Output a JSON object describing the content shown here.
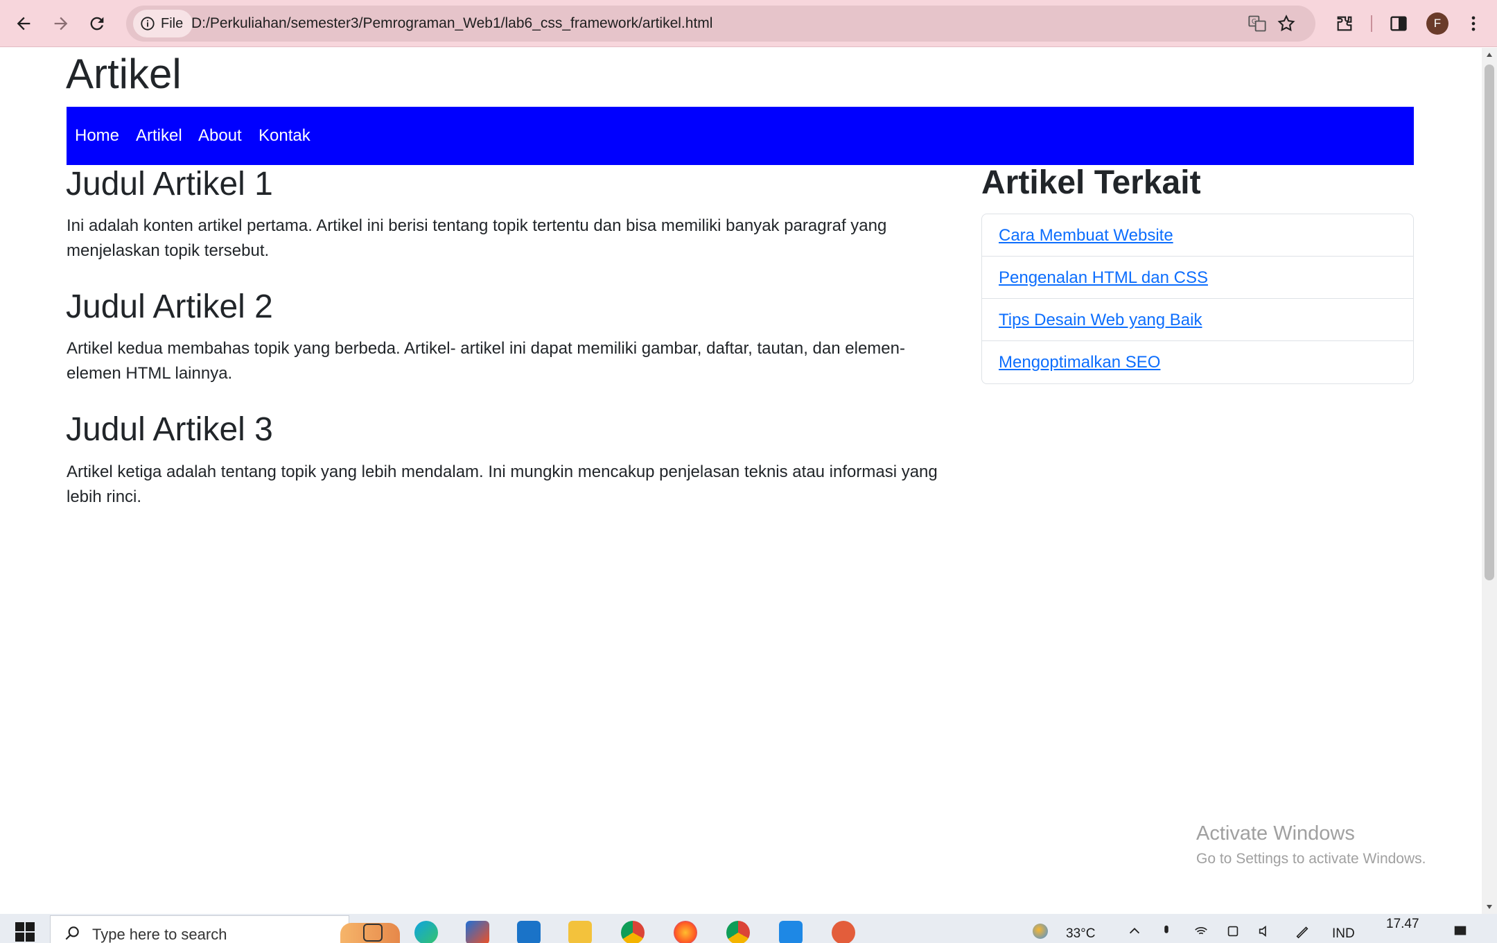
{
  "browser": {
    "site_chip": "File",
    "url": "D:/Perkuliahan/semester3/Pemrograman_Web1/lab6_css_framework/artikel.html",
    "profile_initial": "F"
  },
  "page": {
    "site_title": "Artikel",
    "nav": [
      "Home",
      "Artikel",
      "About",
      "Kontak"
    ],
    "articles": [
      {
        "title": "Judul Artikel 1",
        "line1": "Ini adalah konten artikel pertama. Artikel ini berisi tentang topik tertentu dan bisa memiliki banyak paragraf yang",
        "line2": "menjelaskan topik tersebut."
      },
      {
        "title": "Judul Artikel 2",
        "line1": "Artikel kedua membahas topik yang berbeda. Artikel- artikel ini dapat memiliki gambar, daftar, tautan, dan elemen-",
        "line2": "elemen HTML lainnya."
      },
      {
        "title": "Judul Artikel 3",
        "line1": "Artikel ketiga adalah tentang topik yang lebih mendalam. Ini mungkin mencakup penjelasan teknis atau informasi yang",
        "line2": "lebih rinci."
      }
    ],
    "sidebar": {
      "title": "Artikel Terkait",
      "links": [
        "Cara Membuat Website",
        "Pengenalan HTML dan CSS",
        "Tips Desain Web yang Baik",
        "Mengoptimalkan SEO"
      ]
    }
  },
  "watermark": {
    "title": "Activate Windows",
    "subtitle": "Go to Settings to activate Windows."
  },
  "taskbar": {
    "search_placeholder": "Type here to search",
    "temperature": "33°C",
    "language": "IND",
    "time": "17.47"
  },
  "colors": {
    "navbar": "#0000ff",
    "link": "#0d6efd",
    "chrome": "#f7d6dc"
  }
}
